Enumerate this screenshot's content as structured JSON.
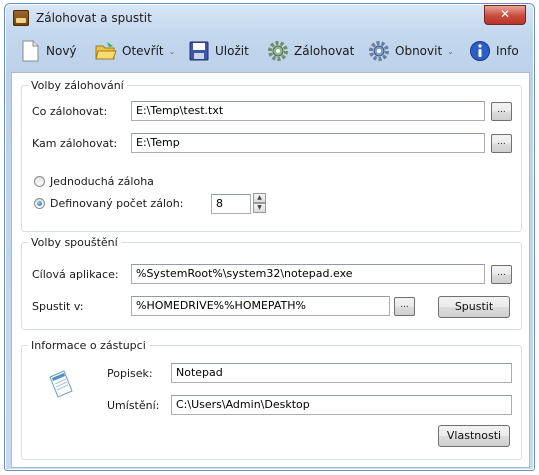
{
  "window": {
    "title": "Zálohovat a spustit",
    "close_glyph": "✕"
  },
  "toolbar": {
    "items": [
      {
        "label": "Nový",
        "icon": "new-document-icon"
      },
      {
        "label": "Otevřít",
        "icon": "open-folder-icon",
        "dropdown": true
      },
      {
        "label": "Uložit",
        "icon": "save-disk-icon"
      },
      {
        "label": "Zálohovat",
        "icon": "backup-gear-icon"
      },
      {
        "label": "Obnovit",
        "icon": "restore-gear-icon",
        "dropdown": true
      },
      {
        "label": "Info",
        "icon": "info-icon"
      }
    ],
    "dropdown_glyph": "⌄"
  },
  "backup_options": {
    "legend": "Volby zálohování",
    "source_label": "Co zálohovat:",
    "source_value": "E:\\Temp\\test.txt",
    "target_label": "Kam zálohovat:",
    "target_value": "E:\\Temp",
    "browse_label": "...",
    "radio_simple": "Jednoduchá záloha",
    "radio_defined": "Definovaný počet záloh:",
    "radio_selected": "defined",
    "count_value": "8"
  },
  "launch_options": {
    "legend": "Volby spouštění",
    "app_label": "Cílová aplikace:",
    "app_value": "%SystemRoot%\\system32\\notepad.exe",
    "run_in_label": "Spustit v:",
    "run_in_value": "%HOMEDRIVE%%HOMEPATH%",
    "browse_label": "...",
    "run_button": "Spustit"
  },
  "shortcut_info": {
    "legend": "Informace o zástupci",
    "icon": "notepad-icon",
    "description_label": "Popisek:",
    "description_value": "Notepad",
    "location_label": "Umístění:",
    "location_value": "C:\\Users\\Admin\\Desktop",
    "properties_button": "Vlastnosti"
  }
}
